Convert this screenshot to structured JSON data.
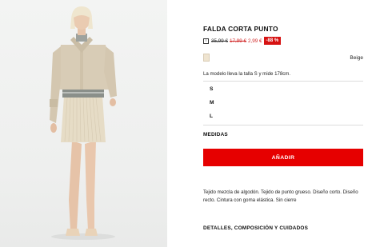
{
  "product": {
    "title": "FALDA CORTA PUNTO",
    "price_original": "35,99 €",
    "price_previous": "17,99 €",
    "price_current": "2,99 €",
    "discount_badge": "-88 %",
    "color_name": "Beige",
    "swatch_color": "#efe4d0",
    "model_note": "La modelo lleva la talla S y mide 178cm.",
    "sizes": [
      "S",
      "M",
      "L"
    ],
    "measures_label": "MEDIDAS",
    "add_button_label": "AÑADIR",
    "description": "Tejido mezcla de algodón. Tejido de punto grueso. Diseño corto. Diseño recto. Cintura con goma elástica. Sin cierre",
    "details_label": "DETALLES, COMPOSICIÓN Y CUIDADOS"
  },
  "colors": {
    "accent_red": "#e60000",
    "badge_red": "#d61212"
  },
  "icons": [
    "info-icon"
  ]
}
